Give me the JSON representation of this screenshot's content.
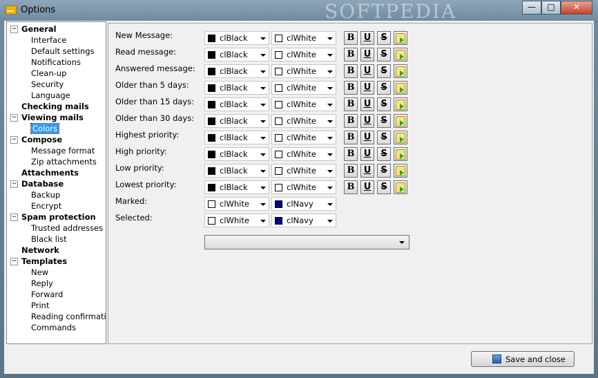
{
  "window": {
    "title": "Options",
    "watermark": "SOFTPEDIA",
    "controls": {
      "minimize": "—",
      "maximize": "□",
      "close": "✕"
    }
  },
  "tree": [
    {
      "label": "General",
      "group": true,
      "expander": "−",
      "children": [
        "Interface",
        "Default settings",
        "Notifications",
        "Clean-up",
        "Security",
        "Language"
      ]
    },
    {
      "label": "Checking mails",
      "group": true,
      "expander": "",
      "children": []
    },
    {
      "label": "Viewing mails",
      "group": true,
      "expander": "−",
      "children": [
        "Colors"
      ]
    },
    {
      "label": "Compose",
      "group": true,
      "expander": "−",
      "children": [
        "Message format",
        "Zip attachments"
      ]
    },
    {
      "label": "Attachments",
      "group": true,
      "expander": "",
      "children": []
    },
    {
      "label": "Database",
      "group": true,
      "expander": "−",
      "children": [
        "Backup",
        "Encrypt"
      ]
    },
    {
      "label": "Spam protection",
      "group": true,
      "expander": "−",
      "children": [
        "Trusted addresses",
        "Black list"
      ]
    },
    {
      "label": "Network",
      "group": true,
      "expander": "",
      "children": []
    },
    {
      "label": "Templates",
      "group": true,
      "expander": "−",
      "children": [
        "New",
        "Reply",
        "Forward",
        "Print",
        "Reading confirmation",
        "Commands"
      ]
    }
  ],
  "selected_tree_item": "Colors",
  "color_rows": [
    {
      "label": "New Message:",
      "fg": "clBlack",
      "fg_color": "#000000",
      "bg": "clWhite",
      "bg_color": "#ffffff",
      "style_buttons": true
    },
    {
      "label": "Read message:",
      "fg": "clBlack",
      "fg_color": "#000000",
      "bg": "clWhite",
      "bg_color": "#ffffff",
      "style_buttons": true
    },
    {
      "label": "Answered message:",
      "fg": "clBlack",
      "fg_color": "#000000",
      "bg": "clWhite",
      "bg_color": "#ffffff",
      "style_buttons": true
    },
    {
      "label": "Older than 5 days:",
      "fg": "clBlack",
      "fg_color": "#000000",
      "bg": "clWhite",
      "bg_color": "#ffffff",
      "style_buttons": true
    },
    {
      "label": "Older than 15 days:",
      "fg": "clBlack",
      "fg_color": "#000000",
      "bg": "clWhite",
      "bg_color": "#ffffff",
      "style_buttons": true
    },
    {
      "label": "Older than 30 days:",
      "fg": "clBlack",
      "fg_color": "#000000",
      "bg": "clWhite",
      "bg_color": "#ffffff",
      "style_buttons": true
    },
    {
      "label": "Highest priority:",
      "fg": "clBlack",
      "fg_color": "#000000",
      "bg": "clWhite",
      "bg_color": "#ffffff",
      "style_buttons": true
    },
    {
      "label": "High priority:",
      "fg": "clBlack",
      "fg_color": "#000000",
      "bg": "clWhite",
      "bg_color": "#ffffff",
      "style_buttons": true
    },
    {
      "label": "Low priority:",
      "fg": "clBlack",
      "fg_color": "#000000",
      "bg": "clWhite",
      "bg_color": "#ffffff",
      "style_buttons": true
    },
    {
      "label": "Lowest priority:",
      "fg": "clBlack",
      "fg_color": "#000000",
      "bg": "clWhite",
      "bg_color": "#ffffff",
      "style_buttons": true
    },
    {
      "label": "Marked:",
      "fg": "clWhite",
      "fg_color": "#ffffff",
      "bg": "clNavy",
      "bg_color": "#000080",
      "style_buttons": false
    },
    {
      "label": "Selected:",
      "fg": "clWhite",
      "fg_color": "#ffffff",
      "bg": "clNavy",
      "bg_color": "#000080",
      "style_buttons": false
    }
  ],
  "style_buttons": {
    "bold": "B",
    "underline": "U",
    "strike": "S"
  },
  "bottom_combo_value": "",
  "save_button": {
    "label": "Save and close"
  },
  "colors": {
    "selection": "#3399ff",
    "panel_bg": "#f0f0f0"
  }
}
